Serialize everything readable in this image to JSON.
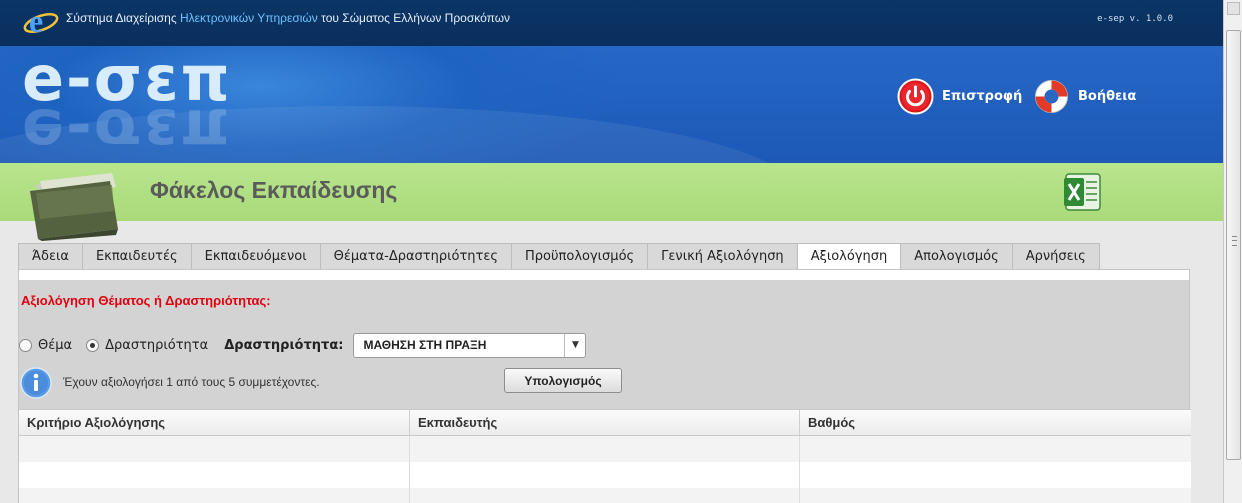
{
  "header": {
    "title_part1": "Σύστημα Διαχείρισης ",
    "title_highlight": "Ηλεκτρονικών Υπηρεσιών",
    "title_part2": " του Σώματος Ελλήνων Προσκόπων",
    "version": "e-sep v. 1.0.0"
  },
  "banner": {
    "brand": "e-σεπ",
    "back_label": "Επιστροφή",
    "help_label": "Βοήθεια"
  },
  "section": {
    "title": "Φάκελος Εκπαίδευσης"
  },
  "tabs": [
    {
      "label": "Άδεια",
      "active": false
    },
    {
      "label": "Εκπαιδευτές",
      "active": false
    },
    {
      "label": "Εκπαιδευόμενοι",
      "active": false
    },
    {
      "label": "Θέματα-Δραστηριότητες",
      "active": false
    },
    {
      "label": "Προϋπολογισμός",
      "active": false
    },
    {
      "label": "Γενική Αξιολόγηση",
      "active": false
    },
    {
      "label": "Αξιολόγηση",
      "active": true
    },
    {
      "label": "Απολογισμός",
      "active": false
    },
    {
      "label": "Αρνήσεις",
      "active": false
    }
  ],
  "evaluation": {
    "heading": "Αξιολόγηση Θέματος ή Δραστηριότητας:",
    "option_topic": "Θέμα",
    "option_activity": "Δραστηριότητα",
    "selected_option": "activity",
    "activity_label": "Δραστηριότητα:",
    "activity_value": "ΜΑΘΗΣΗ ΣΤΗ ΠΡΑΞΗ",
    "info_text": "Έχουν αξιολογήσει 1 από τους 5 συμμετέχοντες.",
    "calc_button": "Υπολογισμός"
  },
  "grid": {
    "columns": [
      "Κριτήριο Αξιολόγησης",
      "Εκπαιδευτής",
      "Βαθμός"
    ],
    "rows": [
      [
        "",
        "",
        ""
      ],
      [
        "",
        "",
        ""
      ],
      [
        "",
        "",
        ""
      ]
    ]
  },
  "colors": {
    "topbar": "#0b2f5d",
    "banner": "#1f63c0",
    "section_green": "#b0df82",
    "heading_red": "#e0000f"
  }
}
